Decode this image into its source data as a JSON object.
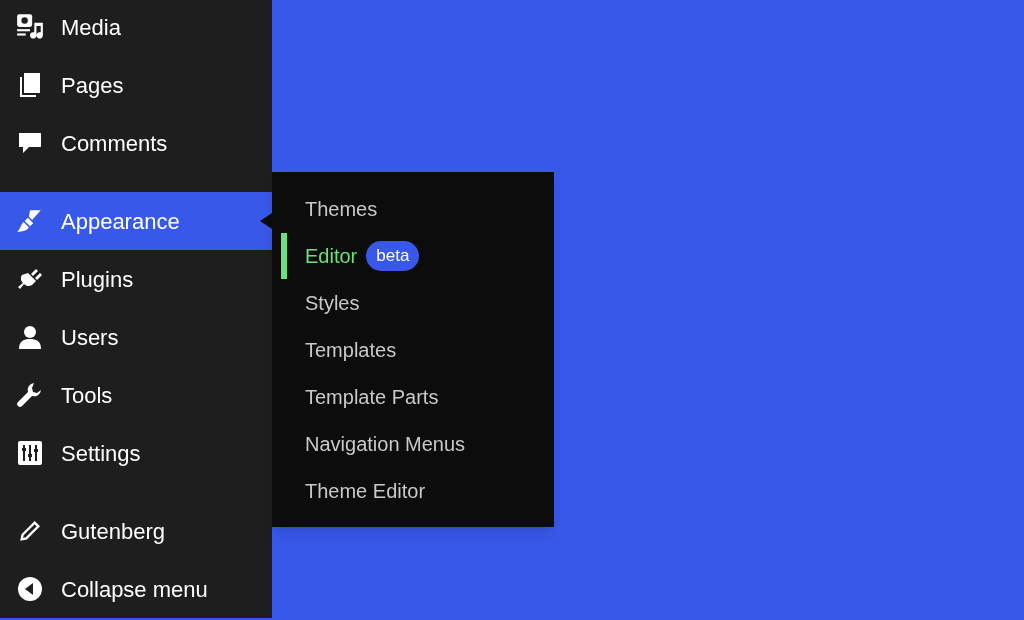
{
  "sidebar": {
    "groups": [
      {
        "items": [
          {
            "label": "Media",
            "selected": false
          },
          {
            "label": "Pages",
            "selected": false
          },
          {
            "label": "Comments",
            "selected": false
          }
        ]
      },
      {
        "items": [
          {
            "label": "Appearance",
            "selected": true
          },
          {
            "label": "Plugins",
            "selected": false
          },
          {
            "label": "Users",
            "selected": false
          },
          {
            "label": "Tools",
            "selected": false
          },
          {
            "label": "Settings",
            "selected": false
          }
        ]
      },
      {
        "items": [
          {
            "label": "Gutenberg",
            "selected": false
          },
          {
            "label": "Collapse menu",
            "selected": false
          }
        ]
      }
    ]
  },
  "submenu": {
    "items": [
      {
        "label": "Themes",
        "selected": false
      },
      {
        "label": "Editor",
        "selected": true,
        "badge": "beta"
      },
      {
        "label": "Styles",
        "selected": false
      },
      {
        "label": "Templates",
        "selected": false
      },
      {
        "label": "Template Parts",
        "selected": false
      },
      {
        "label": "Navigation Menus",
        "selected": false
      },
      {
        "label": "Theme Editor",
        "selected": false
      }
    ]
  }
}
